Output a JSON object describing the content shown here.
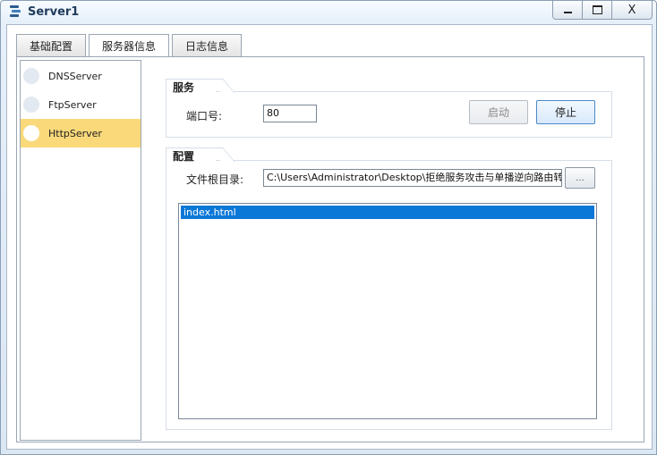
{
  "window": {
    "title": "Server1",
    "controls": {
      "minimize_icon": "minimize-icon",
      "maximize_icon": "maximize-icon",
      "close_label": "X"
    }
  },
  "tabs": [
    {
      "label": "基础配置",
      "active": false
    },
    {
      "label": "服务器信息",
      "active": true
    },
    {
      "label": "日志信息",
      "active": false
    }
  ],
  "sidebar": {
    "items": [
      {
        "label": "DNSServer",
        "selected": false
      },
      {
        "label": "FtpServer",
        "selected": false
      },
      {
        "label": "HttpServer",
        "selected": true
      }
    ]
  },
  "service": {
    "group_title": "服务",
    "port_label": "端口号:",
    "port_value": "80",
    "start_label": "启动",
    "stop_label": "停止"
  },
  "config": {
    "group_title": "配置",
    "root_label": "文件根目录:",
    "root_value": "C:\\Users\\Administrator\\Desktop\\拒绝服务攻击与单播逆向路由转",
    "browse_label": "...",
    "files": [
      "index.html"
    ]
  },
  "colors": {
    "selected_item_bg": "#f9d97a",
    "selected_file_bg": "#0b78d7",
    "title_text": "#1e3b5c"
  }
}
